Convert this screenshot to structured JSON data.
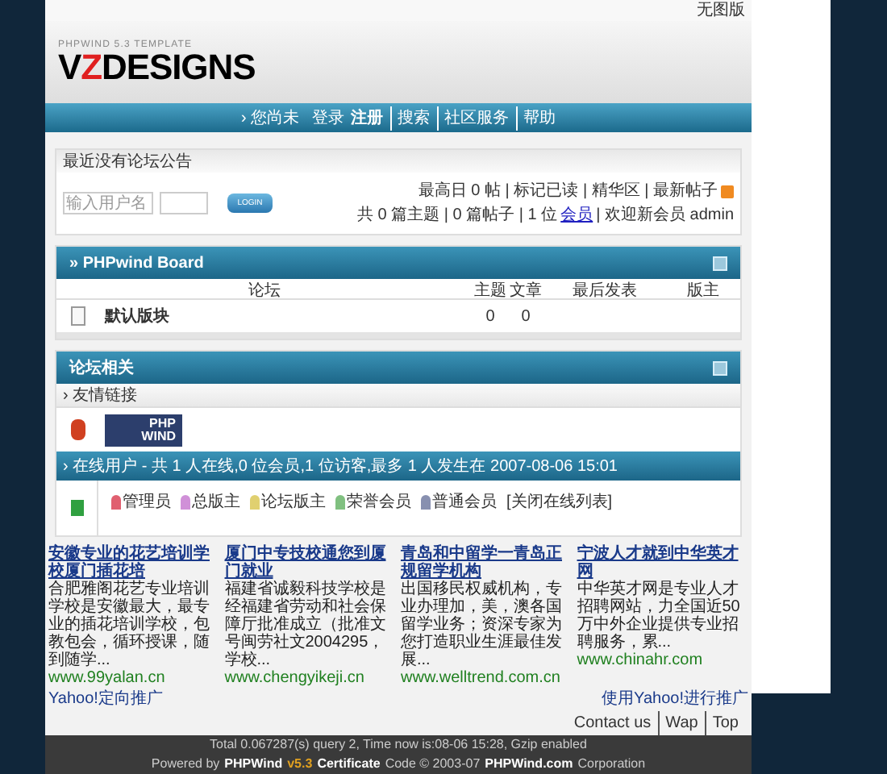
{
  "top_link": "无图版",
  "logo": {
    "tagline": "PHPWIND 5.3 TEMPLATE",
    "name_parts": [
      {
        "text": "V",
        "accent": false
      },
      {
        "text": "Z",
        "accent": true
      },
      {
        "text": "DESIGNS",
        "accent": false
      }
    ]
  },
  "nav": {
    "marker": "›",
    "greeting": "您尚未",
    "items": [
      {
        "label": "登录",
        "bold": false
      },
      {
        "label": "注册",
        "bold": true
      },
      {
        "label": "搜索",
        "bold": false
      },
      {
        "label": "社区服务",
        "bold": false
      },
      {
        "label": "帮助",
        "bold": false
      }
    ]
  },
  "announcement": "最近没有论坛公告",
  "login": {
    "placeholder": "输入用户名",
    "button": "LOGIN"
  },
  "stats": [
    [
      {
        "text": "最高日 0 帖 | 标记已读 | 精华区 | 最新帖子",
        "kind": "text"
      }
    ],
    [
      {
        "text": "共 0 篇主题 | 0 篇帖子 | 1 位",
        "kind": "text"
      },
      {
        "text": "会员",
        "kind": "link"
      },
      {
        "text": "| 欢迎新会员 admin",
        "kind": "text"
      }
    ]
  ],
  "board": {
    "title": "» PHPwind Board",
    "columns": [
      "论坛",
      "主题",
      "文章",
      "最后发表",
      "版主"
    ],
    "rows": [
      {
        "name": "默认版块",
        "topics": "0",
        "posts": "0"
      }
    ]
  },
  "related": {
    "title": "论坛相关",
    "links_header": "› 友情链接",
    "link_logo": [
      "PHP",
      "WIND"
    ],
    "online_header": "› 在线用户 - 共 1 人在线,0 位会员,1 位访客,最多 1 人发生在 2007-08-06 15:01",
    "legend": [
      {
        "label": "管理员",
        "color": "#e06070"
      },
      {
        "label": "总版主",
        "color": "#d090d8"
      },
      {
        "label": "论坛版主",
        "color": "#e0d070"
      },
      {
        "label": "荣誉会员",
        "color": "#80c080"
      },
      {
        "label": "普通会员",
        "color": "#8890b0"
      }
    ],
    "close_list": "[关闭在线列表]"
  },
  "ads": [
    {
      "title": "安徽专业的花艺培训学校厦门插花培",
      "body": "合肥雅阁花艺专业培训学校是安徽最大，最专业的插花培训学校，包教包会，循环授课，随到随学...",
      "url": "www.99yalan.cn"
    },
    {
      "title": "厦门中专技校通您到厦门就业",
      "body": "福建省诚毅科技学校是经福建省劳动和社会保障厅批准成立（批准文号闽劳社文2004295，学校...",
      "url": "www.chengyikeji.cn"
    },
    {
      "title": "青岛和中留学一青岛正规留学机构",
      "body": "出国移民权威机构，专业办理加，美，澳各国留学业务；资深专家为您打造职业生涯最佳发展...",
      "url": "www.welltrend.com.cn"
    },
    {
      "title": "宁波人才就到中华英才网",
      "body": "中华英才网是专业人才招聘网站，力全国近50万中外企业提供专业招聘服务，累...",
      "url": "www.chinahr.com"
    }
  ],
  "sponsor": "Yahoo!定向推广",
  "sponsor_right": "使用Yahoo!进行推广",
  "footer_links": [
    "Contact us",
    "Wap",
    "Top"
  ],
  "footer_line1": "Total 0.067287(s) query 2, Time now is:08-06 15:28, Gzip enabled",
  "footer_line2": [
    {
      "text": "Powered by",
      "kind": "plain"
    },
    {
      "text": "PHPWind",
      "kind": "bold"
    },
    {
      "text": "v5.3",
      "kind": "version"
    },
    {
      "text": "Certificate",
      "kind": "bold"
    },
    {
      "text": "Code © 2003-07",
      "kind": "plain"
    },
    {
      "text": "PHPWind.com",
      "kind": "bold"
    },
    {
      "text": "Corporation",
      "kind": "plain"
    }
  ]
}
